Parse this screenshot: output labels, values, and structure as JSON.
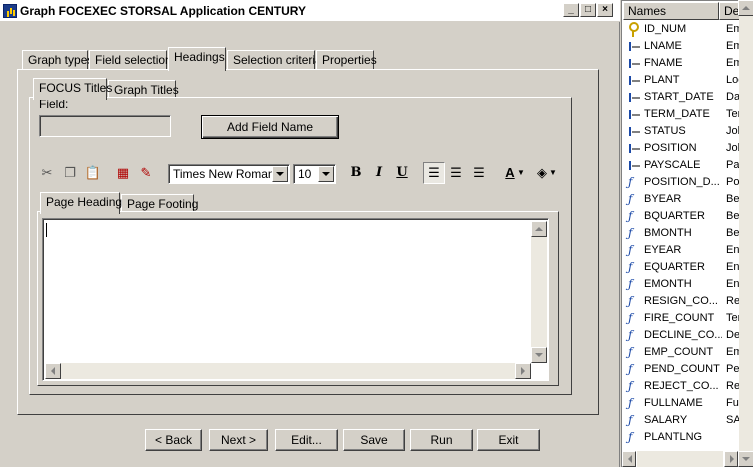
{
  "window": {
    "title": "Graph FOCEXEC STORSAL Application CENTURY",
    "controls": {
      "minimize": "_",
      "maximize": "□",
      "close": "×"
    }
  },
  "main_tabs": [
    {
      "label": "Graph types",
      "active": false
    },
    {
      "label": "Field selection",
      "active": false
    },
    {
      "label": "Headings",
      "active": true
    },
    {
      "label": "Selection criteria",
      "active": false
    },
    {
      "label": "Properties",
      "active": false
    }
  ],
  "title_tabs": [
    {
      "label": "FOCUS Titles",
      "active": true
    },
    {
      "label": "Graph Titles",
      "active": false
    }
  ],
  "field": {
    "label": "Field:",
    "value": ""
  },
  "add_field_button": "Add Field Name",
  "toolbar": {
    "font_family": "Times New Roman",
    "font_size": "10",
    "bold": "B",
    "italic": "I",
    "underline": "U",
    "font_color": "A"
  },
  "heading_tabs": [
    {
      "label": "Page Heading",
      "active": true
    },
    {
      "label": "Page Footing",
      "active": false
    }
  ],
  "editor": {
    "value": ""
  },
  "bottom_buttons": {
    "back": "< Back",
    "next": "Next >",
    "edit": "Edit...",
    "save": "Save",
    "run": "Run",
    "exit": "Exit"
  },
  "field_list": {
    "columns": [
      "Names",
      "Desc"
    ],
    "rows": [
      {
        "name": "ID_NUM",
        "desc": "Empl",
        "icon": "key"
      },
      {
        "name": "LNAME",
        "desc": "Empl",
        "icon": "field"
      },
      {
        "name": "FNAME",
        "desc": "Empl",
        "icon": "field"
      },
      {
        "name": "PLANT",
        "desc": "Locat",
        "icon": "field"
      },
      {
        "name": "START_DATE",
        "desc": "Date",
        "icon": "field"
      },
      {
        "name": "TERM_DATE",
        "desc": "Term",
        "icon": "field"
      },
      {
        "name": "STATUS",
        "desc": "Job S",
        "icon": "field"
      },
      {
        "name": "POSITION",
        "desc": "Job P",
        "icon": "field"
      },
      {
        "name": "PAYSCALE",
        "desc": "Pay L",
        "icon": "field"
      },
      {
        "name": "POSITION_D...",
        "desc": "Positi",
        "icon": "calc"
      },
      {
        "name": "BYEAR",
        "desc": "Begin",
        "icon": "calc"
      },
      {
        "name": "BQUARTER",
        "desc": "Begin",
        "icon": "calc"
      },
      {
        "name": "BMONTH",
        "desc": "Begin",
        "icon": "calc"
      },
      {
        "name": "EYEAR",
        "desc": "Endin",
        "icon": "calc"
      },
      {
        "name": "EQUARTER",
        "desc": "Endin",
        "icon": "calc"
      },
      {
        "name": "EMONTH",
        "desc": "Endin",
        "icon": "calc"
      },
      {
        "name": "RESIGN_CO...",
        "desc": "Resig",
        "icon": "calc"
      },
      {
        "name": "FIRE_COUNT",
        "desc": "Term",
        "icon": "calc"
      },
      {
        "name": "DECLINE_CO...",
        "desc": "Declin",
        "icon": "calc"
      },
      {
        "name": "EMP_COUNT",
        "desc": "Emplo",
        "icon": "calc"
      },
      {
        "name": "PEND_COUNT",
        "desc": "Pend",
        "icon": "calc"
      },
      {
        "name": "REJECT_CO...",
        "desc": "Rejec",
        "icon": "calc"
      },
      {
        "name": "FULLNAME",
        "desc": "Full N",
        "icon": "calc"
      },
      {
        "name": "SALARY",
        "desc": "SALA",
        "icon": "calc"
      },
      {
        "name": "PLANTLNG",
        "desc": "",
        "icon": "calc"
      }
    ]
  }
}
